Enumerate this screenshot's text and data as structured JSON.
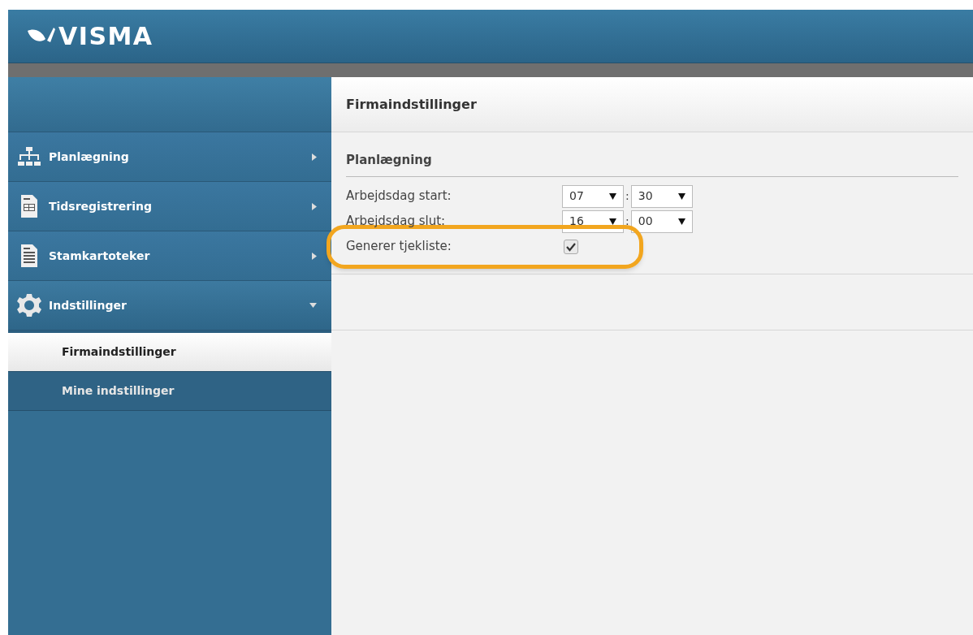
{
  "header": {
    "logo": "VISMA"
  },
  "sidebar": {
    "items": [
      {
        "label": "Planlægning",
        "expanded": false
      },
      {
        "label": "Tidsregistrering",
        "expanded": false
      },
      {
        "label": "Stamkartoteker",
        "expanded": false
      },
      {
        "label": "Indstillinger",
        "expanded": true,
        "children": [
          {
            "label": "Firmaindstillinger",
            "selected": true
          },
          {
            "label": "Mine indstillinger",
            "selected": false
          }
        ]
      }
    ]
  },
  "content": {
    "title": "Firmaindstillinger",
    "section": "Planlægning",
    "rows": [
      {
        "kind": "time",
        "label": "Arbejdsdag start:",
        "hour": "07",
        "separator": ":",
        "minute": "30",
        "highlighted": false
      },
      {
        "kind": "time",
        "label": "Arbejdsdag slut:",
        "hour": "16",
        "separator": ":",
        "minute": "00",
        "highlighted": false
      },
      {
        "kind": "checkbox",
        "label": "Generer tjekliste:",
        "checked": true,
        "highlighted": true
      }
    ]
  }
}
